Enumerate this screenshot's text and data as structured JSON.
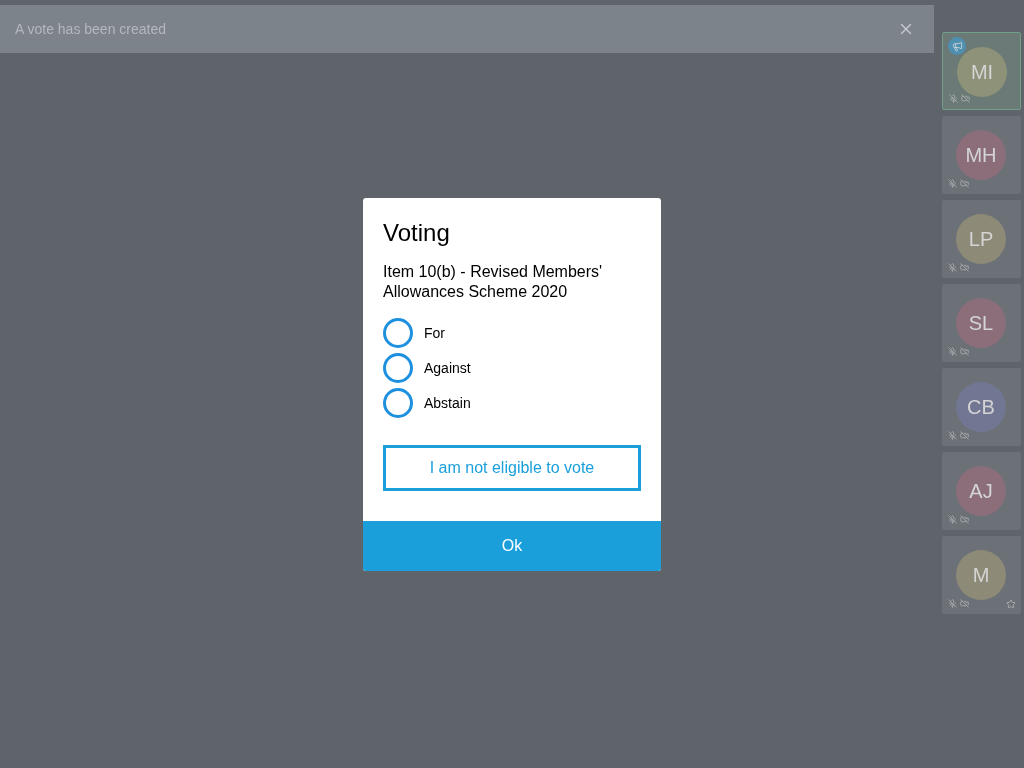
{
  "banner": {
    "message": "A vote has been created"
  },
  "dialog": {
    "title": "Voting",
    "item": "Item 10(b) - Revised Members' Allowances Scheme 2020",
    "options": [
      {
        "label": "For",
        "selected": false
      },
      {
        "label": "Against",
        "selected": false
      },
      {
        "label": "Abstain",
        "selected": false
      }
    ],
    "ineligible_button": "I am not eligible to vote",
    "ok_button": "Ok"
  },
  "participants": [
    {
      "initials": "MI",
      "color": "#8e9278",
      "speaking": true,
      "starred": false
    },
    {
      "initials": "MH",
      "color": "#8b6e7a",
      "speaking": false,
      "starred": false
    },
    {
      "initials": "LP",
      "color": "#8e8a78",
      "speaking": false,
      "starred": false
    },
    {
      "initials": "SL",
      "color": "#8b6e7a",
      "speaking": false,
      "starred": false
    },
    {
      "initials": "CB",
      "color": "#717793",
      "speaking": false,
      "starred": false
    },
    {
      "initials": "AJ",
      "color": "#8b6e7a",
      "speaking": false,
      "starred": false
    },
    {
      "initials": "M",
      "color": "#8e8a78",
      "speaking": false,
      "starred": true
    }
  ]
}
